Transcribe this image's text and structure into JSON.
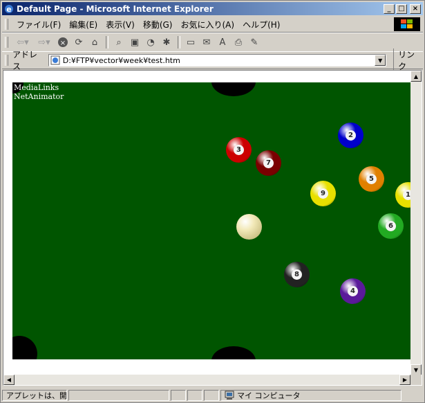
{
  "window": {
    "title": "Default Page - Microsoft Internet Explorer"
  },
  "menubar": {
    "items": [
      "ファイル(F)",
      "編集(E)",
      "表示(V)",
      "移動(G)",
      "お気に入り(A)",
      "ヘルプ(H)"
    ]
  },
  "toolbar": {
    "buttons": [
      "back-icon",
      "forward-icon",
      "stop-icon",
      "refresh-icon",
      "home-icon",
      "search-icon",
      "favorites-icon",
      "history-icon",
      "channels-icon",
      "fullscreen-icon",
      "mail-icon",
      "font-icon",
      "print-icon",
      "edit-icon"
    ]
  },
  "address": {
    "label": "アドレス",
    "url": "D:¥FTP¥vector¥week¥test.htm",
    "links_label": "リンク"
  },
  "applet": {
    "text_line1": "MediaLinks",
    "text_line2": "NetAnimator",
    "felt_color": "#005500",
    "balls": [
      {
        "label": "3",
        "color": "#cc0000"
      },
      {
        "label": "7",
        "color": "#7a0000"
      },
      {
        "label": "2",
        "color": "#0000cc"
      },
      {
        "label": "5",
        "color": "#e08000"
      },
      {
        "label": "9",
        "color": "#e8e000"
      },
      {
        "label": "1",
        "color": "#e8e000"
      },
      {
        "label": "6",
        "color": "#22aa22"
      },
      {
        "label": "8",
        "color": "#222222"
      },
      {
        "label": "4",
        "color": "#5a1a9a"
      },
      {
        "label": "",
        "color": "#f2e9b8"
      }
    ]
  },
  "statusbar": {
    "text": "アプレットは、開始",
    "zone": "マイ コンピュータ"
  }
}
